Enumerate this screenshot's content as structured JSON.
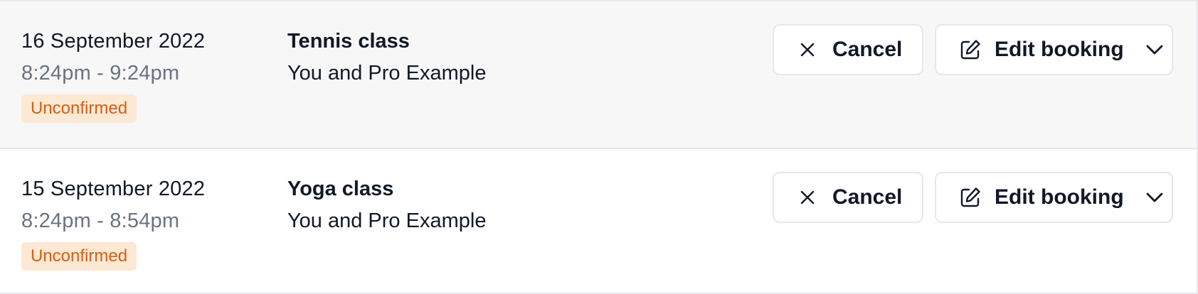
{
  "bookings": [
    {
      "date": "16 September 2022",
      "time": "8:24pm - 9:24pm",
      "status": "Unconfirmed",
      "title": "Tennis class",
      "attendees": "You and Pro Example",
      "cancel_label": "Cancel",
      "edit_label": "Edit booking"
    },
    {
      "date": "15 September 2022",
      "time": "8:24pm - 8:54pm",
      "status": "Unconfirmed",
      "title": "Yoga class",
      "attendees": "You and Pro Example",
      "cancel_label": "Cancel",
      "edit_label": "Edit booking"
    }
  ],
  "icons": {
    "cancel": "close-icon",
    "edit": "edit-icon",
    "dropdown": "chevron-down-icon"
  },
  "colors": {
    "row_highlight_bg": "#f7f7f7",
    "badge_bg": "#fde8d3",
    "badge_text": "#d55e17",
    "secondary_text": "#6b7280",
    "border": "#e5e7eb"
  }
}
